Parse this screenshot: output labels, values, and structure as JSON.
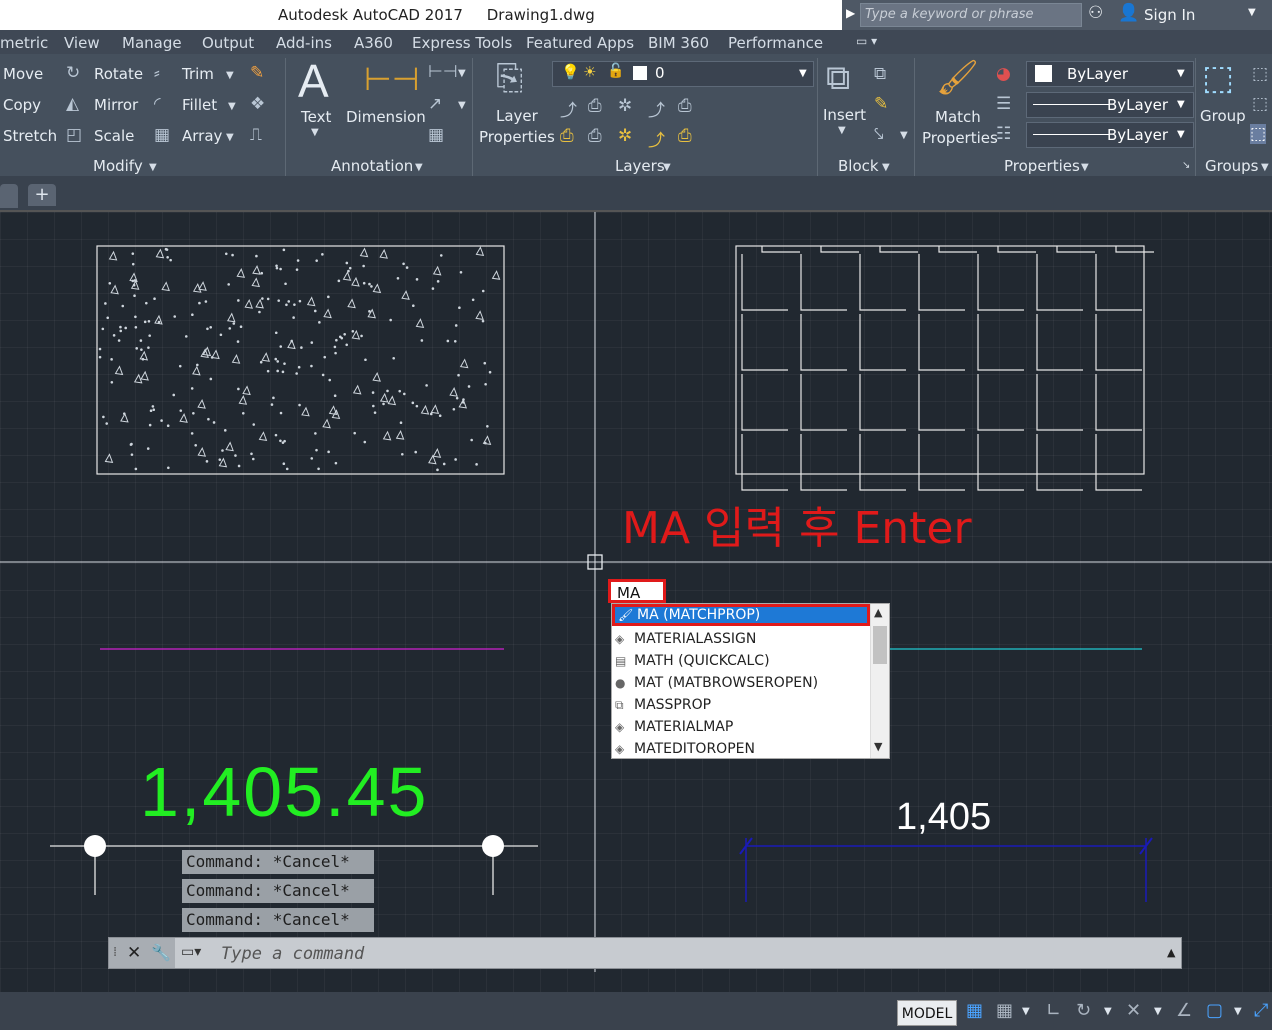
{
  "titlebar": {
    "title": "Autodesk AutoCAD 2017     Drawing1.dwg",
    "search_placeholder": "Type a keyword or phrase",
    "signin": "Sign In"
  },
  "tabs": [
    "metric",
    "View",
    "Manage",
    "Output",
    "Add-ins",
    "A360",
    "Express Tools",
    "Featured Apps",
    "BIM 360",
    "Performance"
  ],
  "ribbon": {
    "modify": {
      "title": "Modify",
      "move": "Move",
      "copy": "Copy",
      "stretch": "Stretch",
      "rotate": "Rotate",
      "mirror": "Mirror",
      "scale": "Scale",
      "trim": "Trim",
      "fillet": "Fillet",
      "array": "Array"
    },
    "annotation": {
      "title": "Annotation",
      "text": "Text",
      "dimension": "Dimension"
    },
    "layers": {
      "title": "Layers",
      "layer_properties_1": "Layer",
      "layer_properties_2": "Properties",
      "current_layer": "0"
    },
    "block": {
      "title": "Block",
      "insert": "Insert"
    },
    "properties": {
      "title": "Properties",
      "match_1": "Match",
      "match_2": "Properties",
      "color": "ByLayer",
      "linetype": "ByLayer",
      "lineweight": "ByLayer"
    },
    "groups": {
      "title": "Groups",
      "group": "Group"
    }
  },
  "canvas": {
    "annotation": "MA 입력 후 Enter",
    "dim_big": "1,405.45",
    "dim_right": "1,405",
    "history": [
      "Command: *Cancel*",
      "Command: *Cancel*",
      "Command: *Cancel*"
    ]
  },
  "autocomplete": {
    "input": "MA",
    "items": [
      "MA (MATCHPROP)",
      "MATERIALASSIGN",
      "MATH (QUICKCALC)",
      "MAT (MATBROWSEROPEN)",
      "MASSPROP",
      "MATERIALMAP",
      "MATEDITOROPEN"
    ]
  },
  "cmdline": {
    "placeholder": "Type a command"
  },
  "statusbar": {
    "model": "MODEL"
  },
  "colors": {
    "accent_red": "#e01a1a",
    "dim_green": "#22ee22",
    "magenta": "#d020d0",
    "cyan": "#20c8d0",
    "blue_dim": "#1a1ab8"
  }
}
